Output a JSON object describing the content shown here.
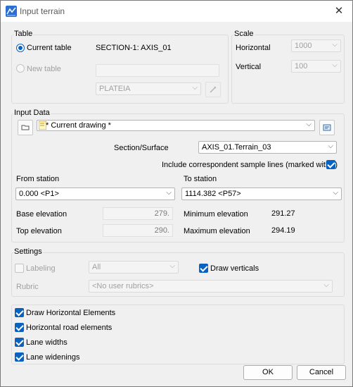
{
  "window": {
    "title": "Input terrain",
    "close": "✕"
  },
  "table_group": {
    "label": "Table",
    "current_table_label": "Current table",
    "current_table_value": "SECTION-1: AXIS_01",
    "new_table_label": "New table",
    "new_table_field": "",
    "platform_combo": "PLATEIA"
  },
  "scale_group": {
    "label": "Scale",
    "horizontal_label": "Horizontal",
    "horizontal_value": "1000",
    "vertical_label": "Vertical",
    "vertical_value": "100"
  },
  "input_group": {
    "label": "Input Data",
    "drawing_combo": "* Current drawing *",
    "section_surface_label": "Section/Surface",
    "section_surface_value": "AXIS_01.Terrain_03",
    "include_sample_label": "Include correspondent sample lines (marked with *)",
    "include_sample_checked": true,
    "from_station_label": "From station",
    "from_station_value": "0.000 <P1>",
    "to_station_label": "To station",
    "to_station_value": "1114.382 <P57>",
    "base_elevation_label": "Base elevation",
    "base_elevation_value": "279.",
    "top_elevation_label": "Top elevation",
    "top_elevation_value": "290.",
    "min_elevation_label": "Minimum elevation",
    "min_elevation_value": "291.27",
    "max_elevation_label": "Maximum elevation",
    "max_elevation_value": "294.19"
  },
  "settings_group": {
    "label": "Settings",
    "labeling_label": "Labeling",
    "labeling_value": "All",
    "draw_verticals_label": "Draw verticals",
    "draw_verticals_checked": true,
    "rubric_label": "Rubric",
    "rubric_value": "<No user rubrics>"
  },
  "elements_group": {
    "draw_horizontal_label": "Draw Horizontal Elements",
    "horizontal_road_label": "Horizontal road elements",
    "lane_widths_label": "Lane widths",
    "lane_widenings_label": "Lane widenings"
  },
  "buttons": {
    "ok": "OK",
    "cancel": "Cancel"
  },
  "colors": {
    "accent": "#0a62bf",
    "border": "#dcdcdc",
    "background": "#f0f0f0"
  }
}
